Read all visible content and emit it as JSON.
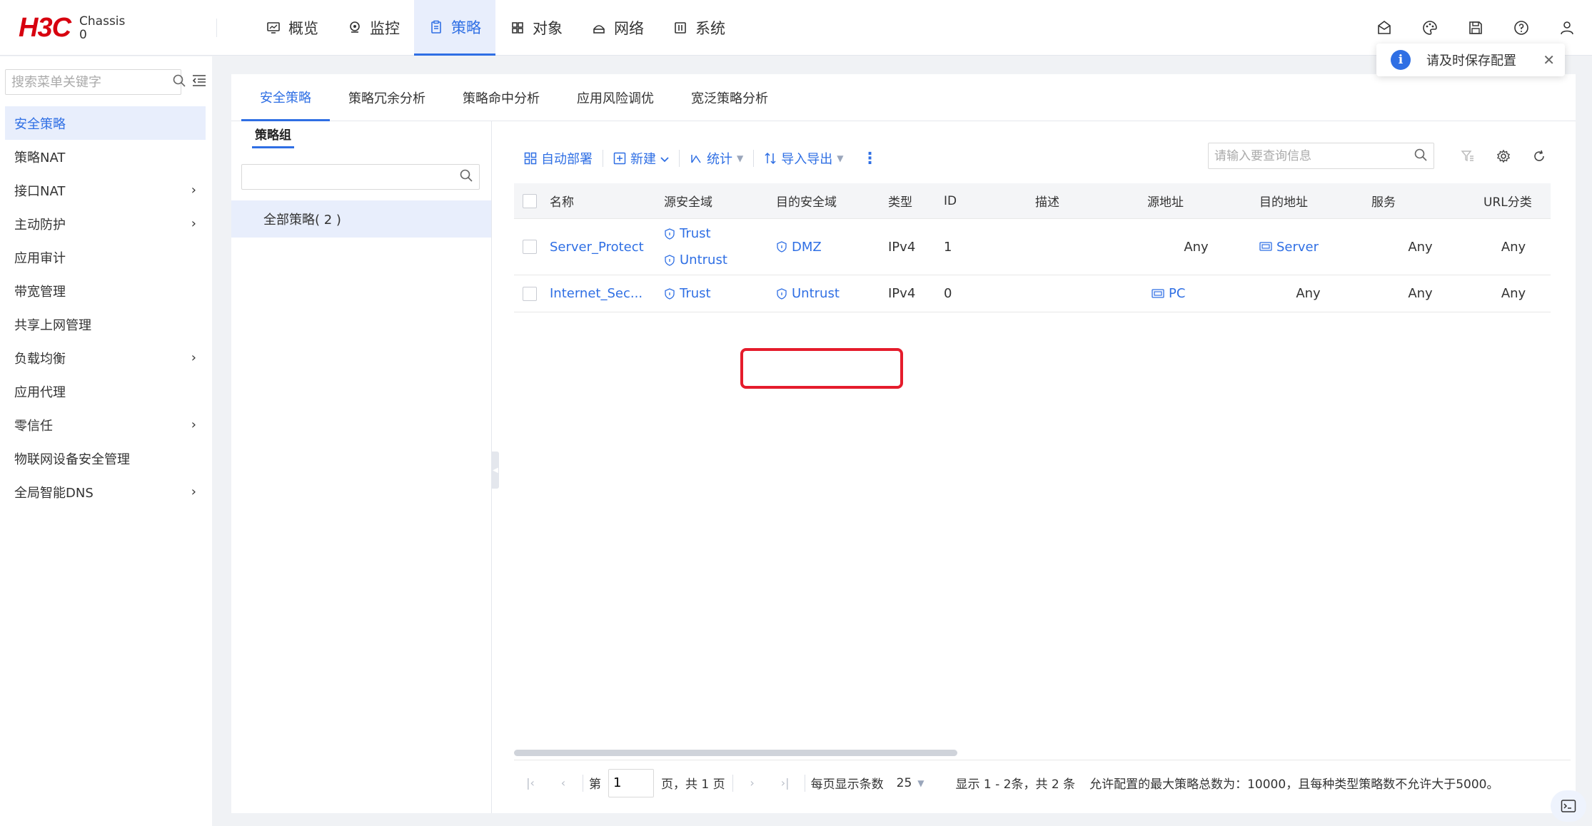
{
  "header": {
    "logo_text": "H3C",
    "device_label": "Chassis",
    "device_number": "0",
    "nav": [
      {
        "label": "概览",
        "icon": "monitor-icon"
      },
      {
        "label": "监控",
        "icon": "location-icon"
      },
      {
        "label": "策略",
        "icon": "clipboard-icon",
        "active": true
      },
      {
        "label": "对象",
        "icon": "grid-icon"
      },
      {
        "label": "网络",
        "icon": "network-icon"
      },
      {
        "label": "系统",
        "icon": "system-icon"
      }
    ],
    "right_icons": [
      "mail-icon",
      "palette-icon",
      "save-icon",
      "help-icon",
      "user-icon"
    ]
  },
  "toast": {
    "text": "请及时保存配置"
  },
  "sidebar": {
    "search_placeholder": "搜索菜单关键字",
    "items": [
      {
        "label": "安全策略",
        "active": true,
        "has_children": false
      },
      {
        "label": "策略NAT",
        "has_children": false
      },
      {
        "label": "接口NAT",
        "has_children": true
      },
      {
        "label": "主动防护",
        "has_children": true
      },
      {
        "label": "应用审计",
        "has_children": false
      },
      {
        "label": "带宽管理",
        "has_children": false
      },
      {
        "label": "共享上网管理",
        "has_children": false
      },
      {
        "label": "负载均衡",
        "has_children": true
      },
      {
        "label": "应用代理",
        "has_children": false
      },
      {
        "label": "零信任",
        "has_children": true
      },
      {
        "label": "物联网设备安全管理",
        "has_children": false
      },
      {
        "label": "全局智能DNS",
        "has_children": true
      }
    ]
  },
  "tabs": [
    {
      "label": "安全策略",
      "active": true
    },
    {
      "label": "策略冗余分析"
    },
    {
      "label": "策略命中分析"
    },
    {
      "label": "应用风险调优"
    },
    {
      "label": "宽泛策略分析"
    }
  ],
  "group_panel": {
    "title": "策略组",
    "search_value": "",
    "item_label": "全部策略( 2 )"
  },
  "toolbar": {
    "auto_deploy": "自动部署",
    "new": "新建",
    "stats": "统计",
    "import_export": "导入导出",
    "search_placeholder": "请输入要查询信息"
  },
  "table": {
    "columns": [
      "名称",
      "源安全域",
      "目的安全域",
      "类型",
      "ID",
      "描述",
      "源地址",
      "目的地址",
      "服务",
      "URL分类"
    ],
    "rows": [
      {
        "name": "Server_Protect",
        "src_zones": [
          "Trust",
          "Untrust"
        ],
        "dst_zone": "DMZ",
        "type": "IPv4",
        "id": "1",
        "desc": "",
        "src_addr": "Any",
        "dst_addr": "Server",
        "service": "Any",
        "url": "Any"
      },
      {
        "name": "Internet_Sec...",
        "src_zones": [
          "Trust"
        ],
        "dst_zone": "Untrust",
        "type": "IPv4",
        "id": "0",
        "desc": "",
        "src_addr": "PC",
        "dst_addr": "Any",
        "service": "Any",
        "url": "Any"
      }
    ]
  },
  "pagination": {
    "page_prefix": "第",
    "page_value": "1",
    "page_suffix": "页，共 1 页",
    "page_size_label": "每页显示条数",
    "page_size": "25",
    "summary": "显示 1 - 2条，共 2 条",
    "limit_note": "允许配置的最大策略总数为：10000，且每种类型策略数不允许大于5000。"
  },
  "colors": {
    "brand_red": "#d7000f",
    "accent_blue": "#2f6fe4",
    "highlight_red": "#e51c2c"
  }
}
